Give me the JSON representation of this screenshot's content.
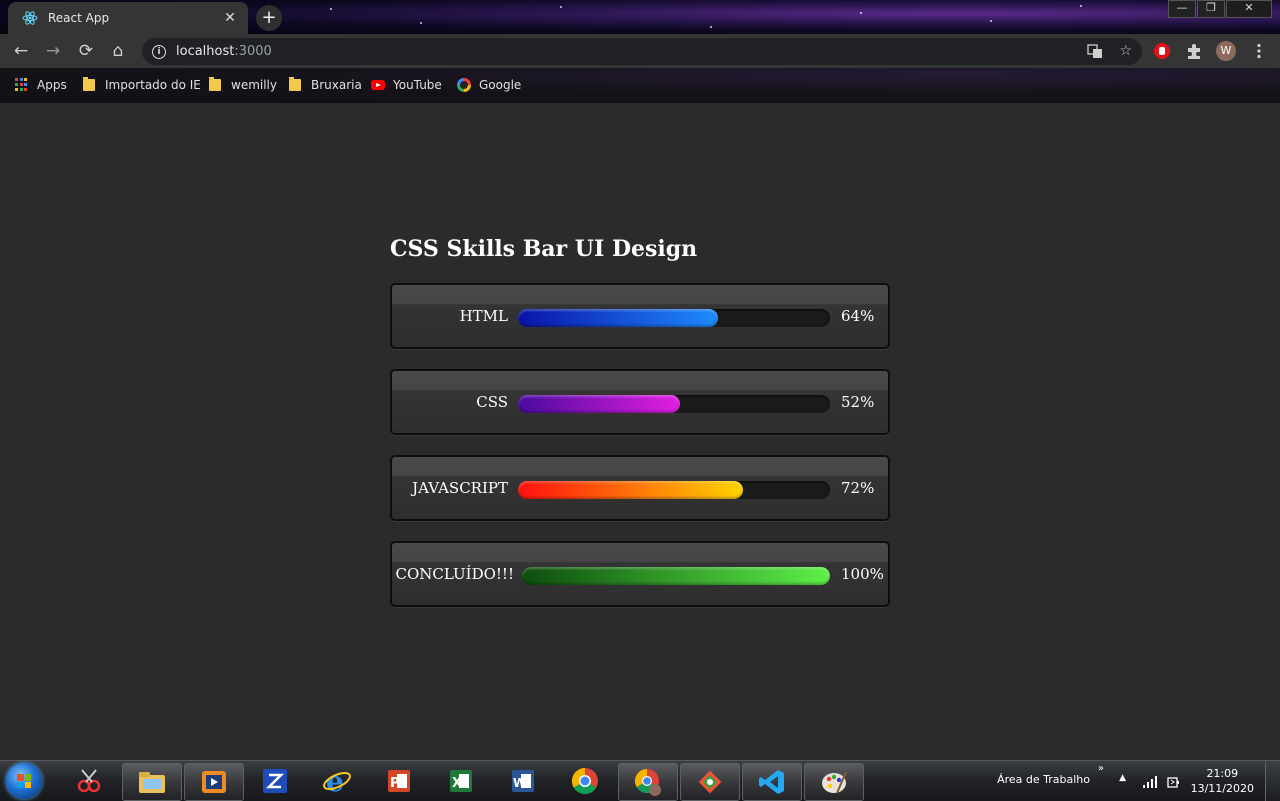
{
  "browser": {
    "tab_title": "React App",
    "tab_close": "✕",
    "new_tab": "+",
    "window_controls": {
      "minimize": "—",
      "restore": "❐",
      "close": "✕"
    },
    "nav": {
      "back": "←",
      "forward": "→",
      "reload": "⟳",
      "home": "⌂"
    },
    "url_host": "localhost",
    "url_port": ":3000",
    "profile_initial": "W",
    "bookmarks": [
      {
        "label": "Apps",
        "icon": "apps-grid-icon"
      },
      {
        "label": "Importado do IE",
        "icon": "folder-icon"
      },
      {
        "label": "wemilly",
        "icon": "folder-icon"
      },
      {
        "label": "Bruxaria",
        "icon": "folder-icon"
      },
      {
        "label": "YouTube",
        "icon": "youtube-icon"
      },
      {
        "label": "Google",
        "icon": "google-icon"
      }
    ]
  },
  "page": {
    "heading": "CSS Skills Bar UI Design",
    "skills": [
      {
        "label": "HTML",
        "percent": 64,
        "percent_text": "64%",
        "colors": [
          "#0a12a8",
          "#1e8bff"
        ]
      },
      {
        "label": "CSS",
        "percent": 52,
        "percent_text": "52%",
        "colors": [
          "#4a0a9e",
          "#e31ee3"
        ]
      },
      {
        "label": "JAVASCRIPT",
        "percent": 72,
        "percent_text": "72%",
        "colors": [
          "#ff1010",
          "#ffd400"
        ]
      },
      {
        "label": "CONCLUÍDO!!!",
        "percent": 100,
        "percent_text": "100%",
        "colors": [
          "#0d4d0d",
          "#5ef04a"
        ]
      }
    ]
  },
  "taskbar": {
    "apps": [
      "snipping-tool-icon",
      "file-explorer-icon",
      "media-player-icon",
      "scanner-icon",
      "internet-explorer-icon",
      "powerpoint-icon",
      "excel-icon",
      "word-icon",
      "chrome-icon",
      "chrome-profile-icon",
      "git-icon",
      "vscode-icon",
      "paint-icon"
    ],
    "desktop_label": "Área de Trabalho",
    "chevron": "»",
    "tray_up": "▲",
    "time": "21:09",
    "date": "13/11/2020"
  }
}
